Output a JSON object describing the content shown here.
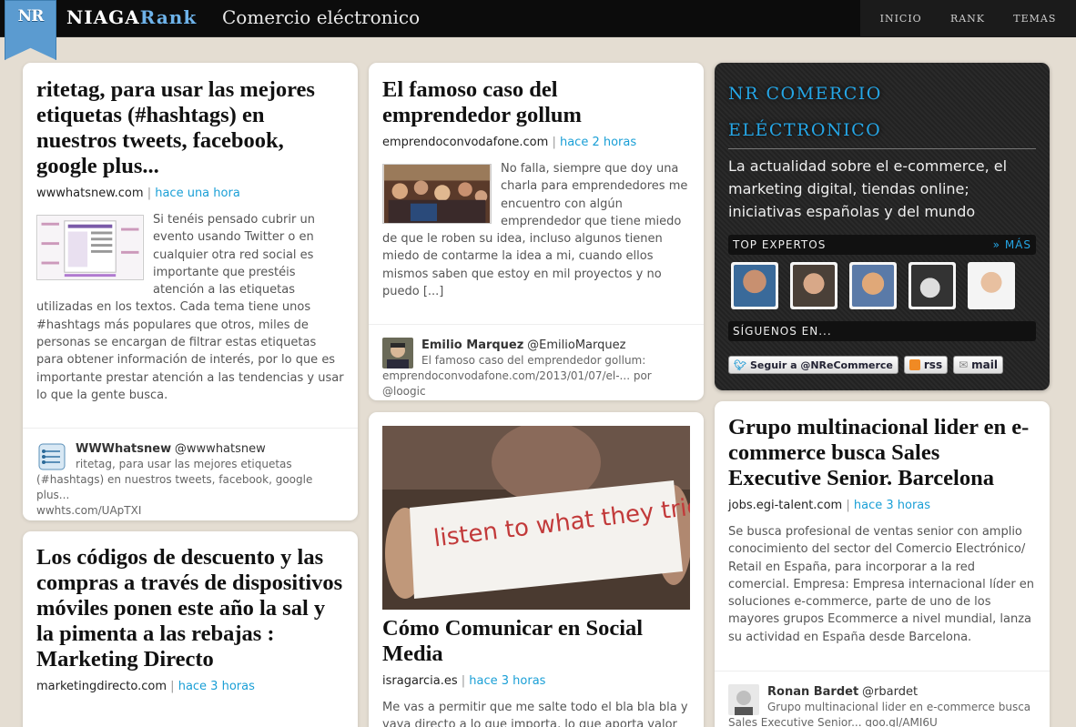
{
  "header": {
    "logo_text": "NR",
    "brand_prefix": "NIAGA",
    "brand_suffix": "Rank",
    "section": "Comercio eléctronico",
    "nav": [
      "INICIO",
      "RANK",
      "TEMAS"
    ]
  },
  "col1": [
    {
      "title": "ritetag, para usar las mejores etiquetas (#hashtags) en nuestros tweets, facebook, google plus...",
      "source": "wwwhatsnew.com",
      "time": "hace una hora",
      "excerpt": "Si tenéis pensado cubrir un evento usando Twitter o en cualquier otra red social es importante que prestéis atención a las etiquetas utilizadas en los textos. Cada tema tiene unos #hashtags más populares que otros, miles de personas se encargan de filtrar estas etiquetas para obtener información de interés, por lo que es importante prestar atención a las tendencias y usar lo que la gente busca.",
      "share": {
        "name": "WWWhatsnew",
        "handle": "@wwwhatsnew",
        "text": "ritetag, para usar las mejores etiquetas (#hashtags) en nuestros tweets, facebook, google plus...",
        "link": "wwhts.com/UApTXI"
      }
    },
    {
      "title": "Los códigos de descuento y las compras a través de dispositivos móviles ponen este año la sal y la pimenta a las rebajas : Marketing Directo",
      "source": "marketingdirecto.com",
      "time": "hace 3 horas"
    }
  ],
  "col2": [
    {
      "title": "El famoso caso del emprendedor gollum",
      "source": "emprendoconvodafone.com",
      "time": "hace 2 horas",
      "excerpt": "No falla, siempre que doy una charla para emprendedores me encuentro con algún emprendedor que tiene miedo de que le roben su idea, incluso algunos tienen miedo de contarme la idea a mi, cuando ellos mismos saben que estoy en mil proyectos y no puedo [...]",
      "share": {
        "name": "Emilio Marquez",
        "handle": "@EmilioMarquez",
        "text": "El famoso caso del emprendedor gollum:",
        "link": "emprendoconvodafone.com/2013/01/07/el-...",
        "via": "por @loogic"
      }
    },
    {
      "image_text": "listen to what they tried to say",
      "title": "Cómo Comunicar en Social Media",
      "source": "isragarcia.es",
      "time": "hace 3 horas",
      "excerpt": "Me vas a permitir que me salte todo el bla bla bla y vaya directo a lo que importa, lo que aporta valor"
    }
  ],
  "widget": {
    "title": "NR COMERCIO ELÉCTRONICO",
    "desc": "La actualidad sobre el e-commerce, el marketing digital, tiendas online; iniciativas españolas y del mundo",
    "experts_label": "TOP EXPERTOS",
    "more_label": "» MÁS",
    "follow_label": "SÍGUENOS EN...",
    "twitter": "Seguir a @NReCommerce",
    "rss": "rss",
    "mail": "mail"
  },
  "col3": [
    {
      "title": "Grupo multinacional lider en e-commerce busca Sales Executive Senior. Barcelona",
      "source": "jobs.egi-talent.com",
      "time": "hace 3 horas",
      "excerpt": "Se busca profesional de ventas senior con amplio conocimiento del sector del Comercio Electrónico/ Retail en España, para incorporar a la red comercial. Empresa: Empresa internacional líder en soluciones e-commerce, parte de uno de los mayores grupos Ecommerce a nivel mundial, lanza su actividad en España desde Barcelona.",
      "share": {
        "name": "Ronan Bardet",
        "handle": "@rbardet",
        "text": "Grupo multinacional lider en e-commerce busca Sales Executive Senior... goo.gl/AMI6U"
      }
    }
  ],
  "colors": {
    "accent": "#1a9fd6",
    "brand_blue": "#5b9bd0",
    "bg": "#e4ddd2"
  }
}
